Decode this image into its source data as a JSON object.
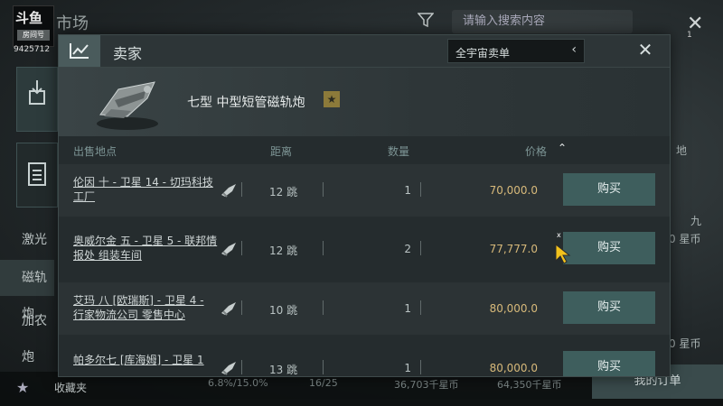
{
  "background": {
    "logo": {
      "line1": "斗鱼",
      "line2": "房间号",
      "room_id": "9425712"
    },
    "market_title": "市场",
    "search_placeholder": "请输入搜索内容",
    "side_items": [
      "激光炮",
      "磁轨炮",
      "加农炮"
    ],
    "bottom": {
      "favorites_label": "收藏夹",
      "stat1": "6.8%/15.0%",
      "stat2": "16/25",
      "stat3": "36,703千星币",
      "stat4": "64,350千星币",
      "my_orders": "我的订单"
    },
    "right_labels": [
      "地",
      "九",
      "0 星币",
      "0 星币"
    ]
  },
  "modal": {
    "title": "卖家",
    "scope_label": "全宇宙卖单",
    "item_name": "七型 中型短管磁轨炮",
    "columns": {
      "location": "出售地点",
      "distance": "距离",
      "quantity": "数量",
      "price": "价格"
    },
    "buy_label": "购买",
    "rows": [
      {
        "location": "伦因 十 - 卫星 14 - 切玛科技 工厂",
        "jumps": "12 跳",
        "qty": "1",
        "price": "70,000.0"
      },
      {
        "location": "奥威尔金 五 - 卫星 5 - 联邦情报处 组装车间",
        "jumps": "12 跳",
        "qty": "2",
        "price": "77,777.0"
      },
      {
        "location": "艾玛 八 [欧瑞斯] - 卫星 4 - 行家物流公司 零售中心",
        "jumps": "10 跳",
        "qty": "1",
        "price": "80,000.0"
      },
      {
        "location": "帕多尔七 [库海姆] - 卫星 1",
        "jumps": "13 跳",
        "qty": "1",
        "price": "80,000.0"
      }
    ]
  },
  "cursor_label": "x"
}
